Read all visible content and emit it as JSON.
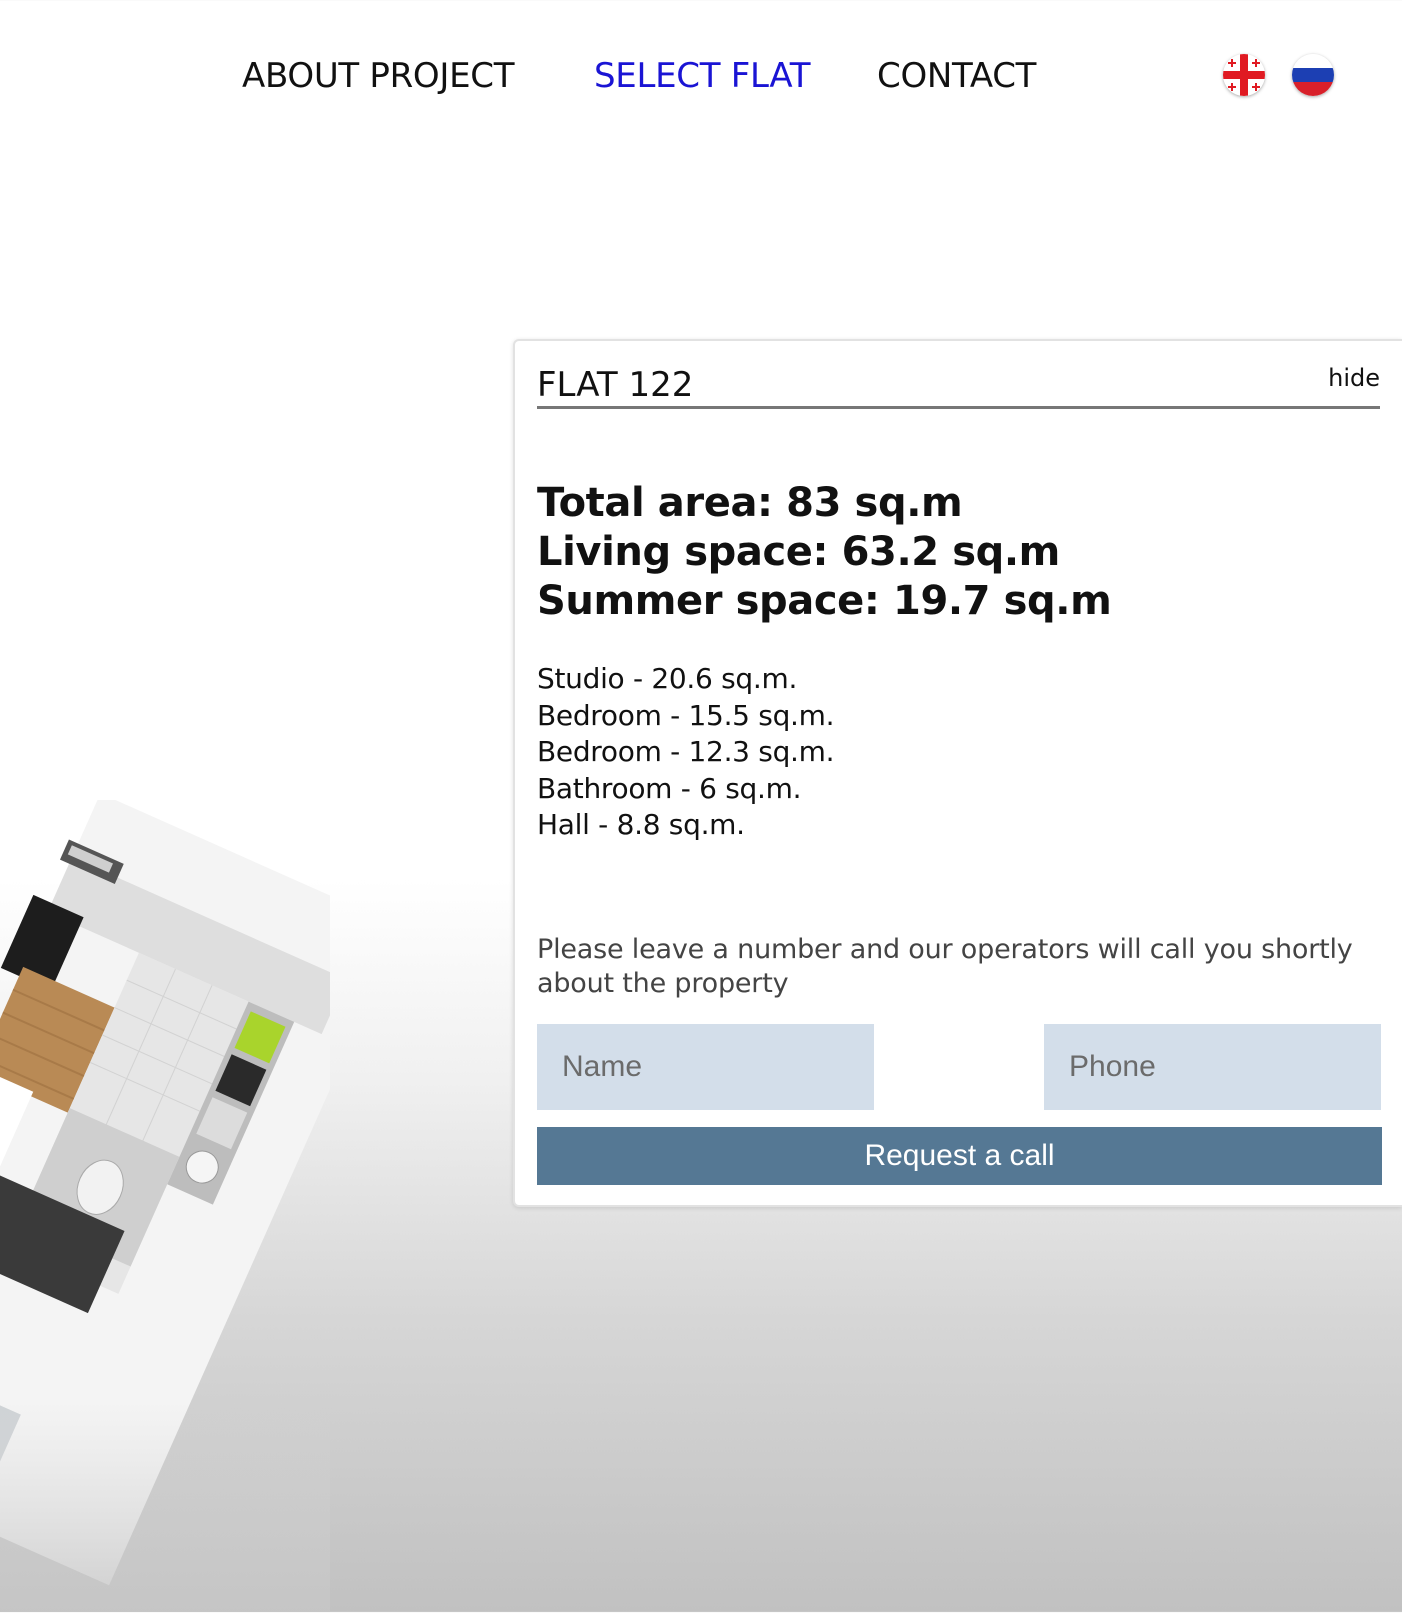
{
  "nav": {
    "items": [
      {
        "label": "ABOUT PROJECT",
        "active": false
      },
      {
        "label": "SELECT FLAT",
        "active": true
      },
      {
        "label": "CONTACT",
        "active": false
      }
    ],
    "languages": [
      {
        "icon": "georgia-flag-icon",
        "code": "ka"
      },
      {
        "icon": "russia-flag-icon",
        "code": "ru"
      }
    ]
  },
  "panel": {
    "title": "FLAT 122",
    "hide_label": "hide",
    "areas": [
      "Total area: 83 sq.m",
      "Living space: 63.2 sq.m",
      "Summer space: 19.7 sq.m"
    ],
    "rooms": [
      "Studio - 20.6 sq.m.",
      "Bedroom - 15.5 sq.m.",
      "Bedroom - 12.3 sq.m.",
      "Bathroom - 6 sq.m.",
      "Hall - 8.8 sq.m."
    ],
    "callback_note": "Please leave a number and our operators will call you shortly about the property",
    "form": {
      "name_placeholder": "Name",
      "phone_placeholder": "Phone",
      "submit_label": "Request a call"
    }
  },
  "colors": {
    "nav_active": "#1a14d4",
    "input_bg": "#d3deea",
    "button_bg": "#557894"
  }
}
